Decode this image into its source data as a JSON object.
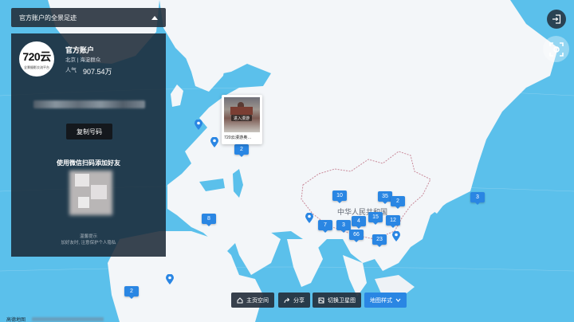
{
  "header": {
    "title": "官方账户的全景足迹"
  },
  "profile": {
    "logo_text": "720云",
    "logo_sub": "全景摄影交流平台",
    "name": "官方账户",
    "location": "北京 | 海淀群众",
    "popularity_label": "人气",
    "popularity_value": "907.54万",
    "copy_button": "复制号码",
    "wechat_label": "使用微信扫码添加好友",
    "tip_title": "温馨提示",
    "tip_text": "加好友时, 注意保护个人隐私"
  },
  "map": {
    "country_label": "中华人民共和国",
    "badges": [
      "2",
      "10",
      "35",
      "2",
      "4",
      "15",
      "12",
      "7",
      "3",
      "66",
      "23",
      "8",
      "2",
      "3"
    ],
    "popup_action": "进入漫游",
    "popup_caption": "720云漫游奥…"
  },
  "toolbar": {
    "home": "主页空间",
    "share": "分享",
    "satellite": "切换卫星图",
    "map_style": "地图样式"
  },
  "footer": {
    "text": "高德地图"
  },
  "colors": {
    "ocean": "#5bc0eb",
    "land": "#f3f6f9",
    "badge": "#2a86e3",
    "panel": "#182634"
  }
}
